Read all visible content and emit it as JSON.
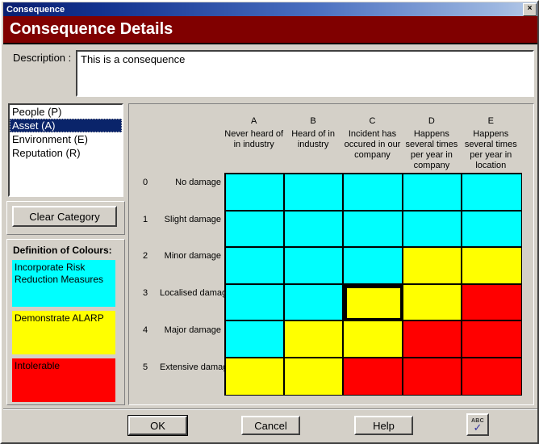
{
  "window": {
    "title": "Consequence",
    "close_label": "×"
  },
  "header": {
    "title": "Consequence Details"
  },
  "description": {
    "label": "Description :",
    "value": "This is a consequence"
  },
  "category_list": {
    "items": [
      {
        "label": "People (P)",
        "selected": false
      },
      {
        "label": "Asset (A)",
        "selected": true
      },
      {
        "label": "Environment (E)",
        "selected": false
      },
      {
        "label": "Reputation (R)",
        "selected": false
      }
    ]
  },
  "clear_category": {
    "label": "Clear Category"
  },
  "legend": {
    "title": "Definition of Colours:",
    "items": [
      {
        "label": "Incorporate Risk Reduction Measures",
        "color": "#00ffff"
      },
      {
        "label": "Demonstrate ALARP",
        "color": "#ffff00"
      },
      {
        "label": "Intolerable",
        "color": "#ff0000"
      }
    ]
  },
  "matrix": {
    "columns": [
      {
        "letter": "A",
        "description": "Never heard of in industry"
      },
      {
        "letter": "B",
        "description": "Heard of in industry"
      },
      {
        "letter": "C",
        "description": "Incident has occured in our company"
      },
      {
        "letter": "D",
        "description": "Happens several times per year in company"
      },
      {
        "letter": "E",
        "description": "Happens several times per year in location"
      }
    ],
    "rows": [
      {
        "number": "0",
        "label": "No damage"
      },
      {
        "number": "1",
        "label": "Slight damage"
      },
      {
        "number": "2",
        "label": "Minor damage"
      },
      {
        "number": "3",
        "label": "Localised damage"
      },
      {
        "number": "4",
        "label": "Major damage"
      },
      {
        "number": "5",
        "label": "Extensive damage"
      }
    ],
    "colors": {
      "cyan": "#00ffff",
      "yellow": "#ffff00",
      "red": "#ff0000"
    },
    "cells": [
      [
        "cyan",
        "cyan",
        "cyan",
        "cyan",
        "cyan"
      ],
      [
        "cyan",
        "cyan",
        "cyan",
        "cyan",
        "cyan"
      ],
      [
        "cyan",
        "cyan",
        "cyan",
        "yellow",
        "yellow"
      ],
      [
        "cyan",
        "cyan",
        "yellow",
        "yellow",
        "red"
      ],
      [
        "cyan",
        "yellow",
        "yellow",
        "red",
        "red"
      ],
      [
        "yellow",
        "yellow",
        "red",
        "red",
        "red"
      ]
    ],
    "selected_cell": {
      "row": 3,
      "col": 2
    }
  },
  "buttons": {
    "ok": "OK",
    "cancel": "Cancel",
    "help": "Help",
    "spellcheck": {
      "text": "ABC",
      "check": "✓"
    }
  },
  "colors": {
    "window_face": "#d4d0c8",
    "header_red": "#800000",
    "title_blue": "#0a246a",
    "selection_blue": "#0a246a"
  }
}
